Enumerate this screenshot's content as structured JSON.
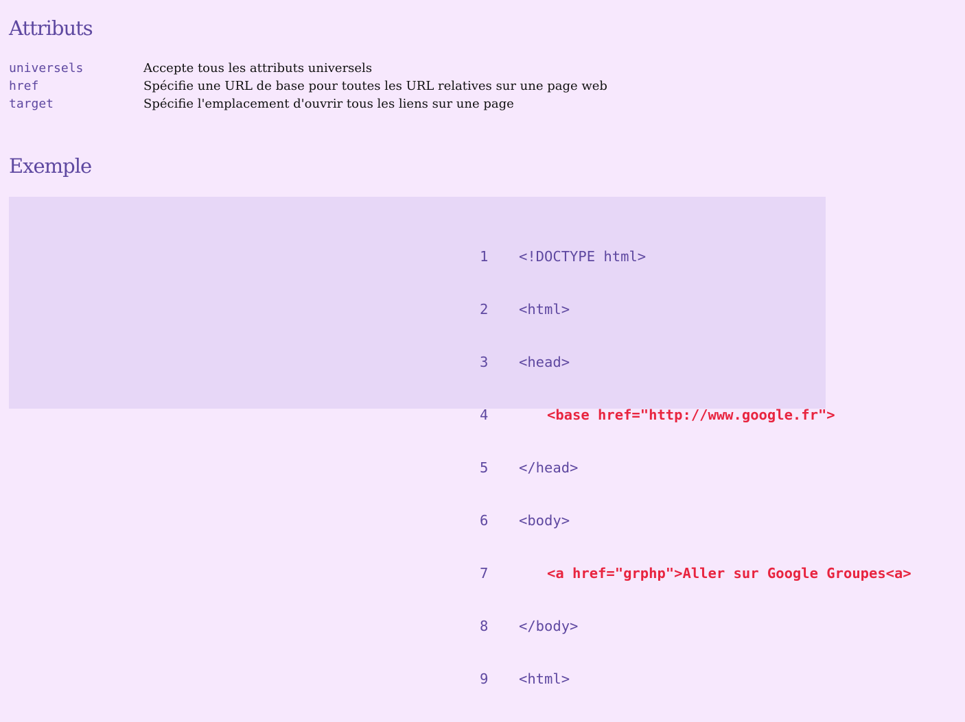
{
  "sections": {
    "attributes_title": "Attributs",
    "example_title": "Exemple"
  },
  "attributes": [
    {
      "name": "universels",
      "description": "Accepte tous les attributs universels"
    },
    {
      "name": "href",
      "description": "Spécifie une URL de base pour toutes les URL relatives sur une page web"
    },
    {
      "name": "target",
      "description": "Spécifie l'emplacement d'ouvrir tous les liens sur une page"
    }
  ],
  "code_example": {
    "lines": [
      {
        "num": "1",
        "text": "<!DOCTYPE html>",
        "highlight": false
      },
      {
        "num": "2",
        "text": "<html>",
        "highlight": false
      },
      {
        "num": "3",
        "text": "<head>",
        "highlight": false
      },
      {
        "num": "4",
        "text": "<base href=\"http://www.google.fr\">",
        "highlight": true
      },
      {
        "num": "5",
        "text": "</head>",
        "highlight": false
      },
      {
        "num": "6",
        "text": "<body>",
        "highlight": false
      },
      {
        "num": "7",
        "text": "<a href=\"grphp\">Aller sur Google Groupes<a>",
        "highlight": true
      },
      {
        "num": "8",
        "text": "</body>",
        "highlight": false
      },
      {
        "num": "9",
        "text": "<html>",
        "highlight": false
      }
    ]
  },
  "colors": {
    "background": "#f7e8fd",
    "heading": "#5e48a0",
    "code_background": "#e7d7f7",
    "code_highlight": "#e8243f"
  }
}
